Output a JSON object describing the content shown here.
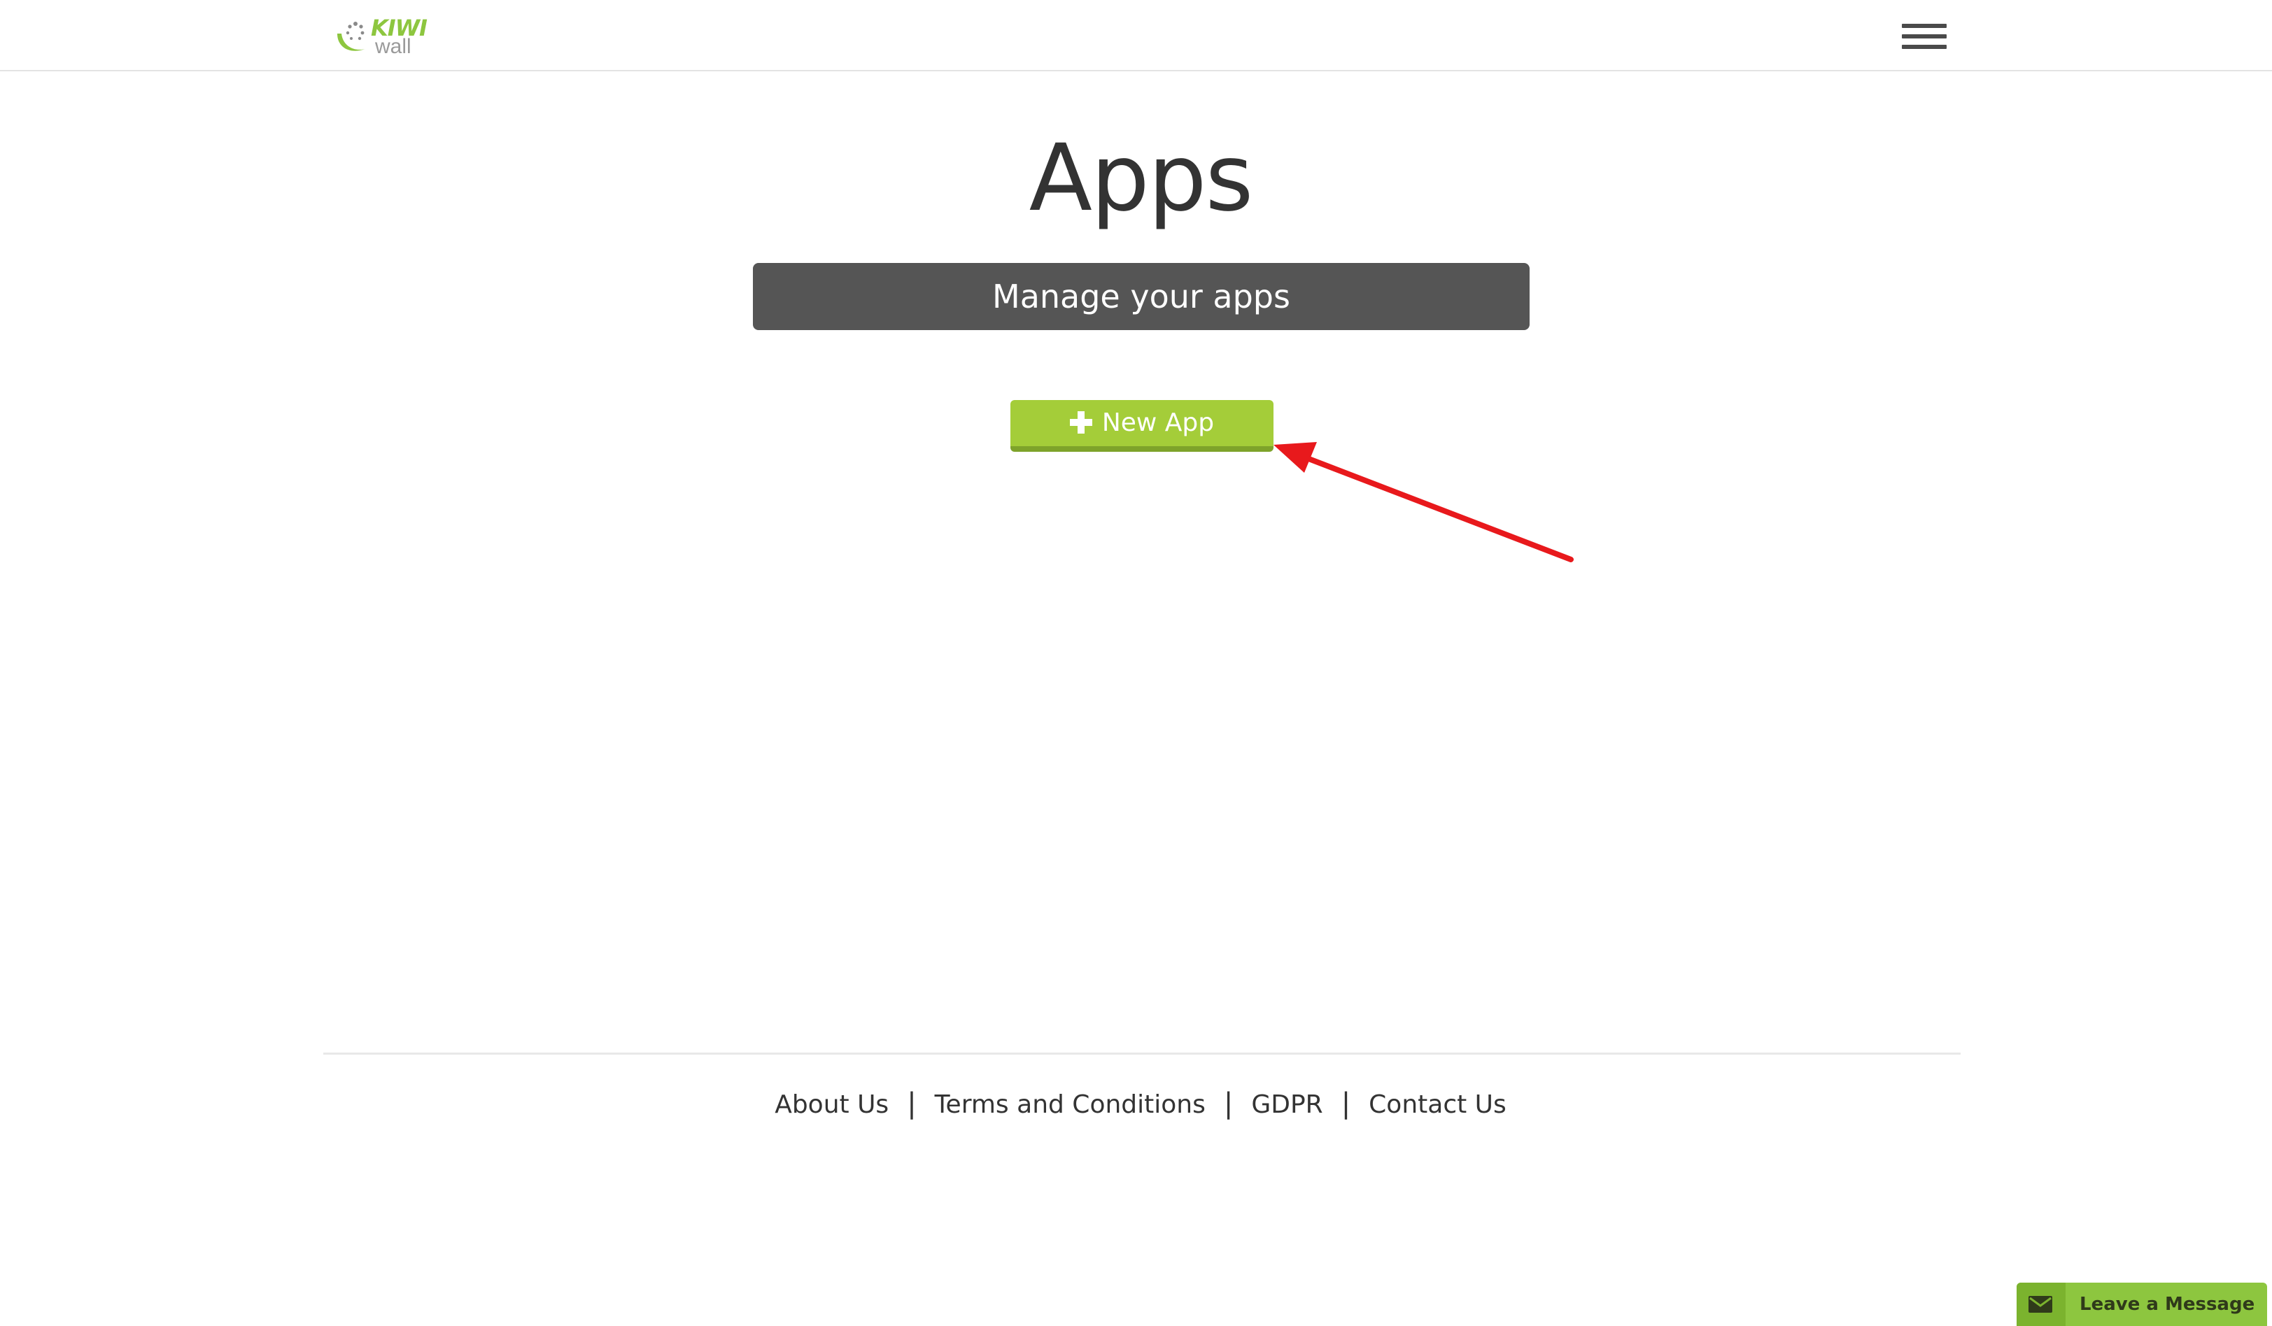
{
  "header": {
    "logo_primary": "KIWI",
    "logo_secondary": "wall",
    "menu_icon": "hamburger-menu-icon"
  },
  "main": {
    "title": "Apps",
    "subtitle": "Manage your apps",
    "new_app_button": {
      "label": "New App",
      "icon": "plus-icon"
    }
  },
  "annotation": {
    "type": "arrow",
    "color": "#e8191c",
    "points_to": "new-app-button"
  },
  "footer": {
    "links": [
      {
        "label": "About Us"
      },
      {
        "label": "Terms and Conditions"
      },
      {
        "label": "GDPR"
      },
      {
        "label": "Contact Us"
      }
    ],
    "separator": "|"
  },
  "chat_widget": {
    "label": "Leave a Message",
    "icon": "envelope-icon"
  },
  "colors": {
    "brand_green": "#a4cd39",
    "brand_green_dark": "#7ea32a",
    "subtitle_bar": "#555555",
    "text": "#333333",
    "widget_green": "#8dc63f"
  }
}
